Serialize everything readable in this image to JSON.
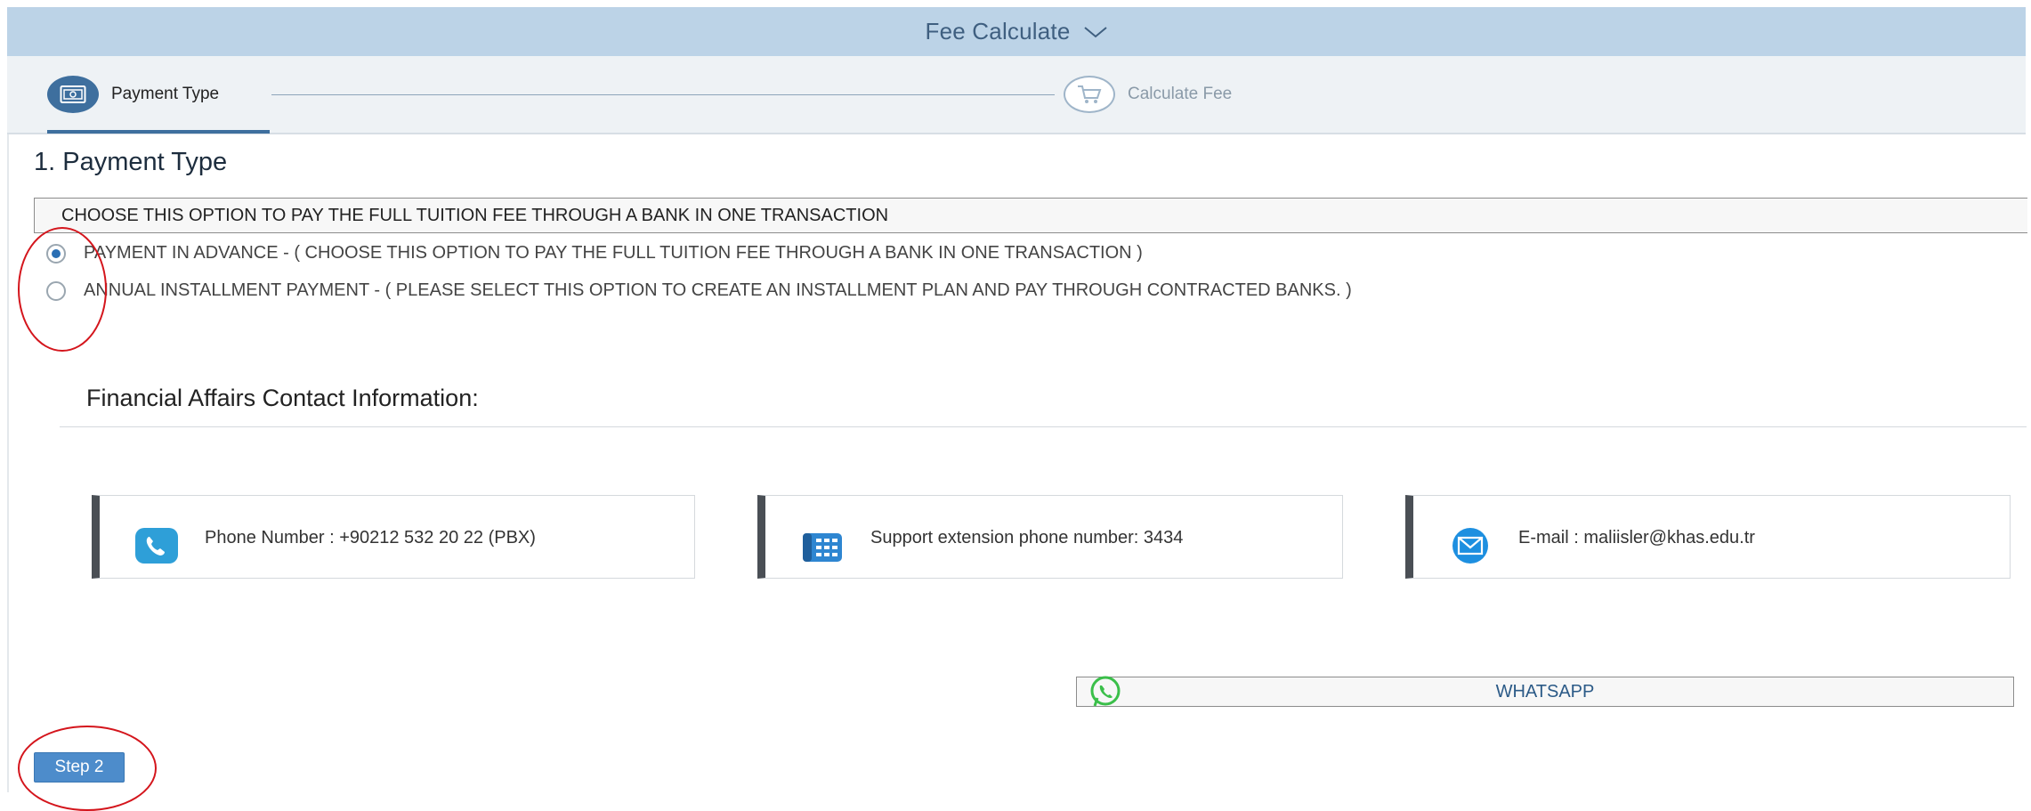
{
  "header": {
    "title": "Fee Calculate",
    "chevron_icon": "chevron-down-icon"
  },
  "wizard": {
    "steps": [
      {
        "label": "Payment Type",
        "icon": "payment-card-icon",
        "active": true
      },
      {
        "label": "Calculate Fee",
        "icon": "shopping-cart-icon",
        "active": false
      }
    ]
  },
  "section": {
    "title": "1. Payment Type",
    "description": "CHOOSE THIS OPTION TO PAY THE FULL TUITION FEE THROUGH A BANK IN ONE TRANSACTION"
  },
  "payment_options": [
    {
      "label": "PAYMENT IN ADVANCE - ( CHOOSE THIS OPTION TO PAY THE FULL TUITION FEE THROUGH A BANK IN ONE TRANSACTION )",
      "selected": true
    },
    {
      "label": "ANNUAL INSTALLMENT PAYMENT - ( PLEASE SELECT THIS OPTION TO CREATE AN INSTALLMENT PLAN AND PAY THROUGH CONTRACTED BANKS. )",
      "selected": false
    }
  ],
  "contact": {
    "title": "Financial Affairs Contact Information:",
    "cards": [
      {
        "icon": "phone-icon",
        "text": "Phone Number : +90212 532 20 22 (PBX)"
      },
      {
        "icon": "desk-phone-icon",
        "text": "Support extension phone number: 3434"
      },
      {
        "icon": "email-icon",
        "text": "E-mail : maliisler@khas.edu.tr"
      }
    ]
  },
  "whatsapp": {
    "label": "WHATSAPP",
    "icon": "whatsapp-icon"
  },
  "actions": {
    "next_label": "Step 2"
  },
  "colors": {
    "header_bg": "#bcd3e7",
    "accent": "#3e6f9e",
    "button": "#4d8ccb",
    "annotation": "#d4151c"
  }
}
